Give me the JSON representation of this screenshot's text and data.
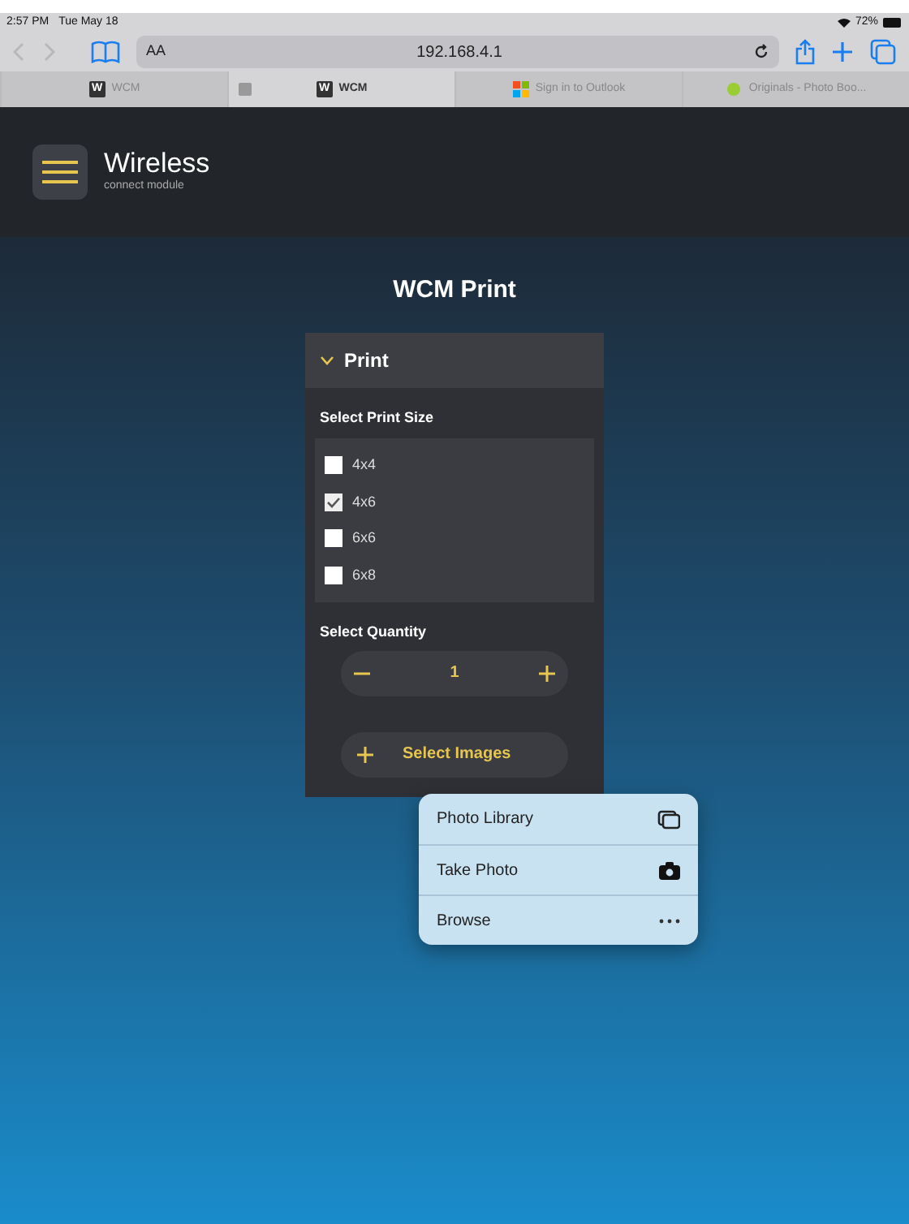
{
  "status_bar": {
    "time": "2:57 PM",
    "date": "Tue May 18",
    "battery": "72%"
  },
  "toolbar": {
    "text_size": "AA",
    "address": "192.168.4.1"
  },
  "tabs": [
    {
      "label": "WCM",
      "selected": false,
      "kind": "letter",
      "logo_text": "W"
    },
    {
      "label": "WCM",
      "selected": true,
      "kind": "letter",
      "logo_text": "W"
    },
    {
      "label": "Sign in to Outlook",
      "selected": false,
      "kind": "grid"
    },
    {
      "label": "Originals - Photo Boo...",
      "selected": false,
      "kind": "leaf"
    }
  ],
  "header": {
    "logo_title": "Wireless",
    "logo_subtitle": "connect module"
  },
  "page_title": "WCM Print",
  "panel": {
    "title": "Print",
    "expanded": true,
    "size_label": "Select Print Size",
    "sizes": [
      {
        "label": "4x4",
        "checked": false
      },
      {
        "label": "4x6",
        "checked": true
      },
      {
        "label": "6x6",
        "checked": false
      },
      {
        "label": "6x8",
        "checked": false
      }
    ],
    "quantity_label": "Select Quantity",
    "quantity": "1",
    "select_images": "Select Images"
  },
  "popup_menu": [
    {
      "label": "Photo Library",
      "kind": "library"
    },
    {
      "label": "Take Photo",
      "kind": "camera"
    },
    {
      "label": "Browse",
      "kind": "more"
    }
  ]
}
